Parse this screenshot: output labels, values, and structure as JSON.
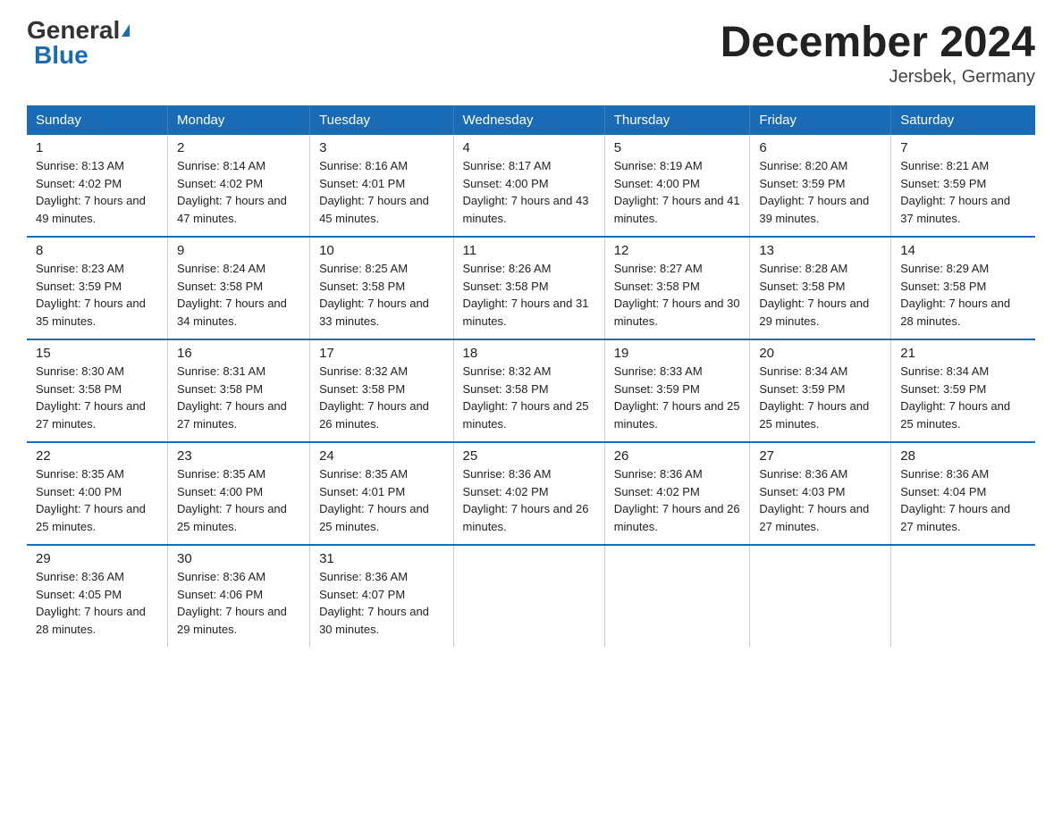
{
  "header": {
    "logo_general": "General",
    "logo_blue": "Blue",
    "month_title": "December 2024",
    "location": "Jersbek, Germany"
  },
  "weekdays": [
    "Sunday",
    "Monday",
    "Tuesday",
    "Wednesday",
    "Thursday",
    "Friday",
    "Saturday"
  ],
  "weeks": [
    [
      {
        "day": "1",
        "sunrise": "8:13 AM",
        "sunset": "4:02 PM",
        "daylight": "7 hours and 49 minutes."
      },
      {
        "day": "2",
        "sunrise": "8:14 AM",
        "sunset": "4:02 PM",
        "daylight": "7 hours and 47 minutes."
      },
      {
        "day": "3",
        "sunrise": "8:16 AM",
        "sunset": "4:01 PM",
        "daylight": "7 hours and 45 minutes."
      },
      {
        "day": "4",
        "sunrise": "8:17 AM",
        "sunset": "4:00 PM",
        "daylight": "7 hours and 43 minutes."
      },
      {
        "day": "5",
        "sunrise": "8:19 AM",
        "sunset": "4:00 PM",
        "daylight": "7 hours and 41 minutes."
      },
      {
        "day": "6",
        "sunrise": "8:20 AM",
        "sunset": "3:59 PM",
        "daylight": "7 hours and 39 minutes."
      },
      {
        "day": "7",
        "sunrise": "8:21 AM",
        "sunset": "3:59 PM",
        "daylight": "7 hours and 37 minutes."
      }
    ],
    [
      {
        "day": "8",
        "sunrise": "8:23 AM",
        "sunset": "3:59 PM",
        "daylight": "7 hours and 35 minutes."
      },
      {
        "day": "9",
        "sunrise": "8:24 AM",
        "sunset": "3:58 PM",
        "daylight": "7 hours and 34 minutes."
      },
      {
        "day": "10",
        "sunrise": "8:25 AM",
        "sunset": "3:58 PM",
        "daylight": "7 hours and 33 minutes."
      },
      {
        "day": "11",
        "sunrise": "8:26 AM",
        "sunset": "3:58 PM",
        "daylight": "7 hours and 31 minutes."
      },
      {
        "day": "12",
        "sunrise": "8:27 AM",
        "sunset": "3:58 PM",
        "daylight": "7 hours and 30 minutes."
      },
      {
        "day": "13",
        "sunrise": "8:28 AM",
        "sunset": "3:58 PM",
        "daylight": "7 hours and 29 minutes."
      },
      {
        "day": "14",
        "sunrise": "8:29 AM",
        "sunset": "3:58 PM",
        "daylight": "7 hours and 28 minutes."
      }
    ],
    [
      {
        "day": "15",
        "sunrise": "8:30 AM",
        "sunset": "3:58 PM",
        "daylight": "7 hours and 27 minutes."
      },
      {
        "day": "16",
        "sunrise": "8:31 AM",
        "sunset": "3:58 PM",
        "daylight": "7 hours and 27 minutes."
      },
      {
        "day": "17",
        "sunrise": "8:32 AM",
        "sunset": "3:58 PM",
        "daylight": "7 hours and 26 minutes."
      },
      {
        "day": "18",
        "sunrise": "8:32 AM",
        "sunset": "3:58 PM",
        "daylight": "7 hours and 25 minutes."
      },
      {
        "day": "19",
        "sunrise": "8:33 AM",
        "sunset": "3:59 PM",
        "daylight": "7 hours and 25 minutes."
      },
      {
        "day": "20",
        "sunrise": "8:34 AM",
        "sunset": "3:59 PM",
        "daylight": "7 hours and 25 minutes."
      },
      {
        "day": "21",
        "sunrise": "8:34 AM",
        "sunset": "3:59 PM",
        "daylight": "7 hours and 25 minutes."
      }
    ],
    [
      {
        "day": "22",
        "sunrise": "8:35 AM",
        "sunset": "4:00 PM",
        "daylight": "7 hours and 25 minutes."
      },
      {
        "day": "23",
        "sunrise": "8:35 AM",
        "sunset": "4:00 PM",
        "daylight": "7 hours and 25 minutes."
      },
      {
        "day": "24",
        "sunrise": "8:35 AM",
        "sunset": "4:01 PM",
        "daylight": "7 hours and 25 minutes."
      },
      {
        "day": "25",
        "sunrise": "8:36 AM",
        "sunset": "4:02 PM",
        "daylight": "7 hours and 26 minutes."
      },
      {
        "day": "26",
        "sunrise": "8:36 AM",
        "sunset": "4:02 PM",
        "daylight": "7 hours and 26 minutes."
      },
      {
        "day": "27",
        "sunrise": "8:36 AM",
        "sunset": "4:03 PM",
        "daylight": "7 hours and 27 minutes."
      },
      {
        "day": "28",
        "sunrise": "8:36 AM",
        "sunset": "4:04 PM",
        "daylight": "7 hours and 27 minutes."
      }
    ],
    [
      {
        "day": "29",
        "sunrise": "8:36 AM",
        "sunset": "4:05 PM",
        "daylight": "7 hours and 28 minutes."
      },
      {
        "day": "30",
        "sunrise": "8:36 AM",
        "sunset": "4:06 PM",
        "daylight": "7 hours and 29 minutes."
      },
      {
        "day": "31",
        "sunrise": "8:36 AM",
        "sunset": "4:07 PM",
        "daylight": "7 hours and 30 minutes."
      },
      null,
      null,
      null,
      null
    ]
  ]
}
